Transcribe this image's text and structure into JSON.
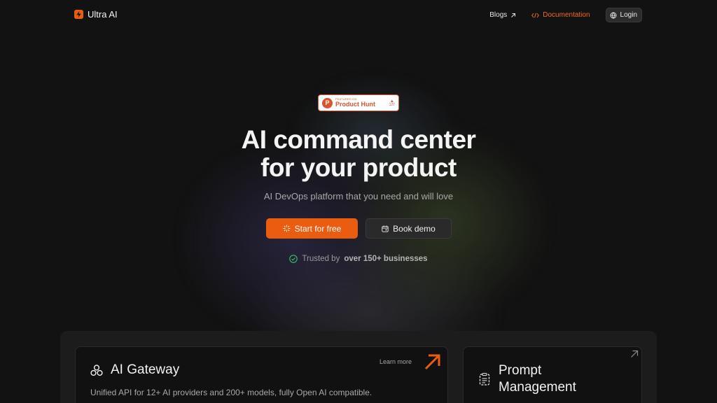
{
  "nav": {
    "brand": "Ultra AI",
    "blogs": "Blogs",
    "documentation": "Documentation",
    "login": "Login"
  },
  "badge": {
    "featured_on": "FEATURED ON",
    "name": "Product Hunt",
    "votes": "127"
  },
  "hero": {
    "title_line1": "AI command center",
    "title_line2": "for your product",
    "subtitle": "AI DevOps platform that you need and will love",
    "primary_cta": "Start for free",
    "secondary_cta": "Book demo",
    "trusted_prefix": "Trusted by",
    "trusted_bold": "over 150+ businesses"
  },
  "features": {
    "gateway": {
      "title": "AI Gateway",
      "description": "Unified API for 12+ AI providers and 200+ models, fully Open AI compatible.",
      "learn_more": "Learn more"
    },
    "prompt": {
      "title_line1": "Prompt",
      "title_line2": "Management"
    }
  },
  "colors": {
    "accent": "#ea5d10",
    "background": "#121212",
    "product_hunt": "#da552f",
    "check": "#3fbf6a"
  },
  "icons": {
    "brand": "bolt-logo-icon",
    "blogs": "arrow-up-right-icon",
    "docs": "code-icon",
    "login": "globe-icon",
    "start": "sparkle-icon",
    "demo": "calendar-icon",
    "trusted": "check-circle-icon",
    "gateway": "nodes-icon",
    "prompt": "document-list-icon"
  }
}
